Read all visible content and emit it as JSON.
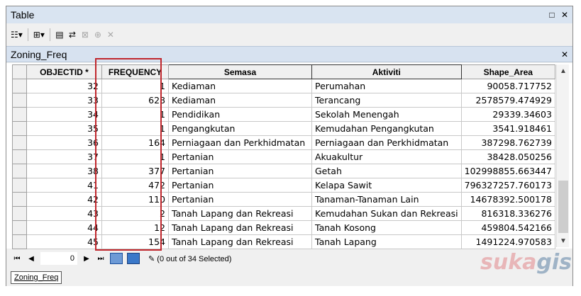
{
  "window": {
    "title": "Table"
  },
  "toolbar": {
    "icons": [
      "table-options-icon",
      "related-tables-icon",
      "select-by-attributes-icon",
      "switch-selection-icon",
      "clear-selection-icon",
      "zoom-to-selected-icon",
      "delete-selected-icon"
    ]
  },
  "tab": {
    "name": "Zoning_Freq"
  },
  "columns": [
    "OBJECTID *",
    "FREQUENCY",
    "Semasa",
    "Aktiviti",
    "Shape_Area"
  ],
  "rows": [
    [
      "32",
      "1",
      "Kediaman",
      "Perumahan",
      "90058.717752"
    ],
    [
      "33",
      "628",
      "Kediaman",
      "Terancang",
      "2578579.474929"
    ],
    [
      "34",
      "1",
      "Pendidikan",
      "Sekolah Menengah",
      "29339.34603"
    ],
    [
      "35",
      "1",
      "Pengangkutan",
      "Kemudahan Pengangkutan",
      "3541.918461"
    ],
    [
      "36",
      "164",
      "Perniagaan dan Perkhidmatan",
      "Perniagaan dan Perkhidmatan",
      "387298.762739"
    ],
    [
      "37",
      "1",
      "Pertanian",
      "Akuakultur",
      "38428.050256"
    ],
    [
      "38",
      "377",
      "Pertanian",
      "Getah",
      "102998855.663447"
    ],
    [
      "41",
      "472",
      "Pertanian",
      "Kelapa Sawit",
      "796327257.760173"
    ],
    [
      "42",
      "110",
      "Pertanian",
      "Tanaman-Tanaman Lain",
      "14678392.500178"
    ],
    [
      "43",
      "2",
      "Tanah Lapang dan Rekreasi",
      "Kemudahan Sukan dan Rekreasi",
      "816318.336276"
    ],
    [
      "44",
      "12",
      "Tanah Lapang dan Rekreasi",
      "Tanah Kosong",
      "459804.542166"
    ],
    [
      "45",
      "154",
      "Tanah Lapang dan Rekreasi",
      "Tanah Lapang",
      "1491224.970583"
    ]
  ],
  "navigation": {
    "current_record": "0",
    "selection_status": "(0 out of 34 Selected)"
  },
  "bottom_tab": "Zoning_Freq",
  "watermark": {
    "part1": "suka",
    "part2": "gis"
  }
}
